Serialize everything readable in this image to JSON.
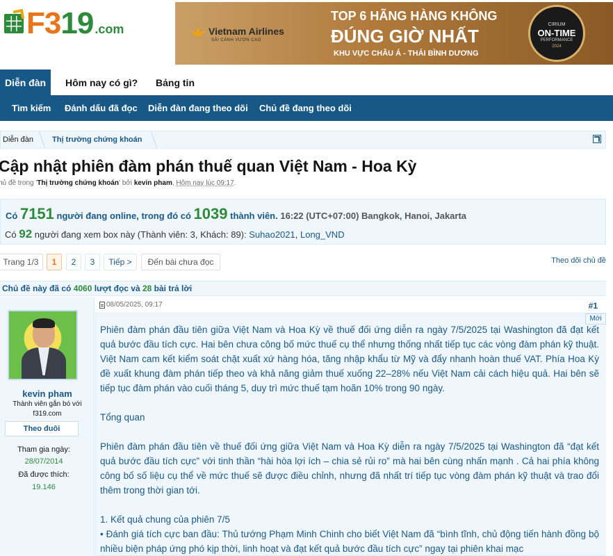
{
  "header": {
    "logo_text_a": "F3",
    "logo_text_b": "19",
    "logo_domain": ".com",
    "banner": {
      "airline": "Vietnam Airlines",
      "airline_tagline": "SẢI CÁNH VƯƠN CAO",
      "line1": "TOP 6 HÃNG HÀNG KHÔNG",
      "line2": "ĐÚNG GIỜ NHẤT",
      "line3": "KHU VỰC CHÂU Á - THÁI BÌNH DƯƠNG",
      "badge_brand": "CIRIUM",
      "badge_main": "ON-TIME",
      "badge_sub": "PERFORMANCE",
      "badge_year": "2024"
    }
  },
  "nav": {
    "tabs": [
      "Diễn đàn",
      "Hôm nay có gì?",
      "Bảng tin"
    ],
    "subnav": [
      "Tìm kiếm",
      "Đánh dấu đã đọc",
      "Diễn đàn đang theo dõi",
      "Chủ đề đang theo dõi"
    ]
  },
  "breadcrumb": [
    "Diễn đàn",
    "Thị trường chứng khoán"
  ],
  "thread": {
    "title": "Cập nhật phiên đàm phán thuế quan Việt Nam - Hoa Kỳ",
    "byline_prefix": "hủ đề trong '",
    "byline_forum": "Thị trường chứng khoán",
    "byline_mid": "' bởi ",
    "byline_author": "kevin pham",
    "byline_comma": ", ",
    "byline_time": "Hôm nay lúc 09:17",
    "byline_end": "."
  },
  "online": {
    "prefix": "Có ",
    "total": "7151",
    "mid": " người đang online, trong đó có ",
    "members": "1039",
    "suffix": " thành viên.",
    "time": " 16:22 (UTC+07:00) Bangkok, Hanoi, Jakarta",
    "box_prefix": "Có ",
    "box_count": "92",
    "box_text": " người đang xem box này (Thành viên: 3, Khách: 89): ",
    "viewer1": "Suhao2021",
    "sep": ", ",
    "viewer2": "Long_VND"
  },
  "pager": {
    "page_of": "Trang 1/3",
    "pages": [
      "1",
      "2",
      "3"
    ],
    "next": "Tiếp >",
    "unread": "Đến bài chưa đọc",
    "follow": "Theo dõi chủ đề"
  },
  "thread_info": {
    "a": "Chủ đề này đã có ",
    "views": "4060",
    "b": " lượt đọc và ",
    "replies": "28",
    "c": " bài trả lời"
  },
  "post": {
    "user": {
      "name": "kevin pham",
      "title_line1": "Thành viên gắn bó với",
      "title_line2": "f319.com",
      "follow": "Theo đuôi",
      "joined_label": "Tham gia ngày:",
      "joined": "28/07/2014",
      "likes_label": "Đã được thích:",
      "likes": "19.146"
    },
    "date": "08/05/2025, 09:17",
    "number": "#1",
    "new_tag": "Mới",
    "paragraphs": [
      "Phiên đàm phán đầu tiên giữa Việt Nam và Hoa Kỳ về thuế đối ứng diễn ra ngày 7/5/2025 tại Washington đã đạt kết quả bước đầu tích cực. Hai bên chưa công bố mức thuế cụ thể nhưng thống nhất tiếp tục các vòng đàm phán kỹ thuật. Việt Nam cam kết kiểm soát chặt xuất xứ hàng hóa, tăng nhập khẩu từ Mỹ và đẩy nhanh hoàn thuế VAT. Phía Hoa Kỳ đề xuất khung đàm phán tiếp theo và khả năng giảm thuế xuống 22–28% nếu Việt Nam cải cách hiệu quả. Hai bên sẽ tiếp tục đàm phán vào cuối tháng 5, duy trì mức thuế tạm hoãn 10% trong 90 ngày.",
      "Tổng quan",
      "Phiên đàm phán đầu tiên về thuế đối ứng giữa Việt Nam và Hoa Kỳ diễn ra ngày 7/5/2025 tại Washington đã “đạt kết quả bước đầu tích cực” với tinh thần “hài hòa lợi ích – chia sẻ rủi ro” mà hai bên cùng nhấn mạnh . Cả hai phía không công bố số liệu cụ thể về mức thuế sẽ được điều chỉnh, nhưng đã nhất trí tiếp tục vòng đàm phán kỹ thuật và trao đổi thêm trong thời gian tới.",
      "1. Kết quả chung của phiên 7/5",
      "• Đánh giá tích cực ban đầu: Thủ tướng Phạm Minh Chinh cho biết Việt Nam đã “bình tĩnh, chủ động tiến hành đồng bộ nhiều biện pháp ứng phó kịp thời, linh hoạt và đạt kết quả bước đầu tích cực” ngay tại phiên khai mạc"
    ]
  }
}
